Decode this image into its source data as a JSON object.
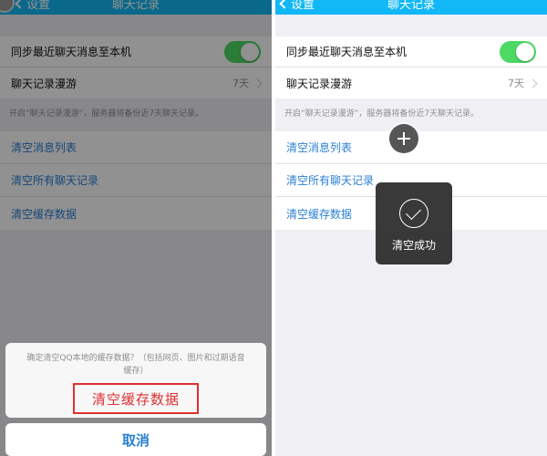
{
  "nav": {
    "back_label": "设置",
    "title": "聊天记录"
  },
  "settings": {
    "sync_label": "同步最近聊天消息至本机",
    "sync_enabled": true,
    "roaming_label": "聊天记录漫游",
    "roaming_value": "7天",
    "roaming_note": "开启“聊天记录漫游”，服务器将备份近7天聊天记录。",
    "clear_message_list": "清空消息列表",
    "clear_all_chats": "清空所有聊天记录",
    "clear_cache": "清空缓存数据"
  },
  "action_sheet": {
    "message": "确定清空QQ本地的缓存数据？（包括网页、图片和过期语音缓存）",
    "confirm_label": "清空缓存数据",
    "cancel_label": "取消"
  },
  "toast": {
    "text": "清空成功"
  },
  "colors": {
    "nav": "#12b7f5",
    "toggle_on": "#4cd964",
    "link": "#2a7fd4",
    "highlight": "#e03030"
  },
  "icons": {
    "back": "chevron-left-icon",
    "plus": "plus-icon",
    "success": "check-circle-icon"
  }
}
